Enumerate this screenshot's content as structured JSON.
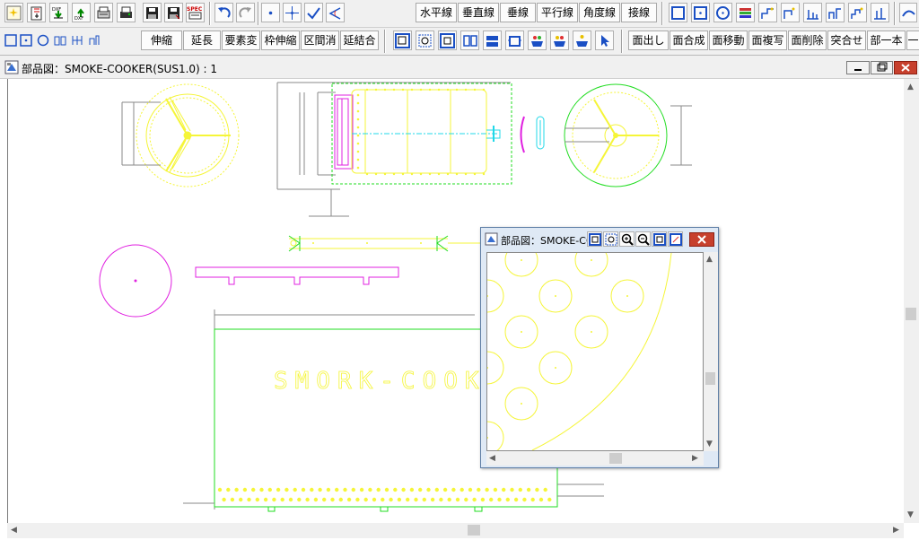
{
  "toolbar2": {
    "geom_buttons": [
      "伸縮",
      "延長",
      "要素変",
      "枠伸縮",
      "区間消",
      "延結合"
    ],
    "face_buttons": [
      "面出し",
      "面合成",
      "面移動",
      "面複写",
      "面削除",
      "突合せ",
      "部一本",
      "一"
    ]
  },
  "toolbar1": {
    "line_buttons": [
      "水平線",
      "垂直線",
      "垂線",
      "平行線",
      "角度線",
      "接線"
    ],
    "spec_icon_text": "SPEC"
  },
  "main_window": {
    "title": "部品図：SMOKE-COOKER(SUS1.0) : 1",
    "drawing_text": "SMORK-COOK"
  },
  "sub_window": {
    "title": "部品図：SMOKE-COO"
  },
  "colors": {
    "yellow": "#f5f538",
    "green": "#22dd22",
    "magenta": "#e020e0",
    "cyan": "#20d8e8",
    "gray": "#8a8a8a",
    "titlebar": "#dfe9f5"
  }
}
